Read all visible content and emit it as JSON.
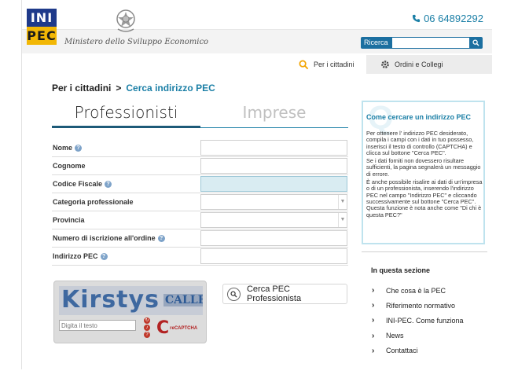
{
  "header": {
    "logo_top": "INI",
    "logo_bottom": "PEC",
    "ministry": "Ministero dello Sviluppo Economico",
    "phone": "06 64892292",
    "search_label": "Ricerca"
  },
  "nav": {
    "citizens": "Per i cittadini",
    "orders": "Ordini e Collegi"
  },
  "breadcrumb": {
    "parent": "Per i cittadini",
    "separator": ">",
    "current": "Cerca indirizzo PEC"
  },
  "tabs": {
    "professionals": "Professionisti",
    "companies": "Imprese"
  },
  "form": {
    "fields": [
      {
        "label": "Nome",
        "help": true
      },
      {
        "label": "Cognome",
        "help": false
      },
      {
        "label": "Codice Fiscale",
        "help": true
      },
      {
        "label": "Categoria professionale",
        "help": false
      },
      {
        "label": "Provincia",
        "help": false
      },
      {
        "label": "Numero di iscrizione all'ordine",
        "help": true
      },
      {
        "label": "Indirizzo PEC",
        "help": true
      }
    ]
  },
  "captcha": {
    "word1": "Kirstys",
    "word2": "CALLE",
    "input_placeholder": "Digita il testo",
    "brand_letter": "C",
    "brand_text": "reCAPTCHA"
  },
  "search_button": "Cerca PEC Professionista",
  "info_box": {
    "title": "Come cercare un indirizzo PEC",
    "p1": "Per ottenere l' indirizzo PEC desiderato, compila i campi con i dati in tuo possesso, inserisci il testo di controllo (CAPTCHA) e clicca sul bottone \"Cerca PEC\".",
    "p2": "Se i dati forniti non dovessero risultare sufficienti, la pagina segnalerà un messaggio di errore.",
    "p3": "È anche possibile risalire ai dati di un'impresa o di un professionista, inserendo l'indirizzo PEC nel campo \"Indirizzo PEC\" e cliccando successivamente sul bottone \"Cerca PEC\". Questa funzione è nota anche come \"Di chi è questa PEC?\""
  },
  "section": {
    "title": "In questa sezione",
    "items": [
      "Che cosa è la PEC",
      "Riferimento normativo",
      "INI-PEC. Come funziona",
      "News",
      "Contattaci"
    ]
  },
  "colors": {
    "brand_blue": "#1f3a8a",
    "brand_yellow": "#f2b705",
    "accent": "#1b7fa6"
  }
}
